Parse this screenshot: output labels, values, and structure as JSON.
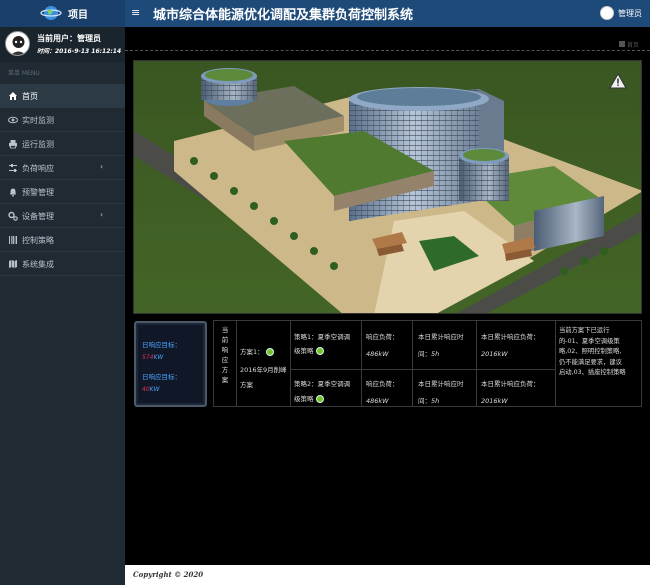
{
  "brand": {
    "label": "项目",
    "icon": "globe-icon"
  },
  "header": {
    "menu_icon": "≡",
    "title": "城市综合体能源优化调配及集群负荷控制系统",
    "user": "管理员"
  },
  "profile": {
    "current_user": "当前用户：管理员",
    "time": "时间：2016-9-13 16:12:14"
  },
  "menu": {
    "header": "菜单 MENU",
    "items": [
      {
        "label": "首页",
        "icon": "home-icon",
        "active": true
      },
      {
        "label": "实时监测",
        "icon": "eye-icon"
      },
      {
        "label": "运行监测",
        "icon": "printer-icon"
      },
      {
        "label": "负荷响应",
        "icon": "sliders-icon",
        "chevron": "‹"
      },
      {
        "label": "预警管理",
        "icon": "bell-icon"
      },
      {
        "label": "设备管理",
        "icon": "gears-icon",
        "chevron": "‹"
      },
      {
        "label": "控制策略",
        "icon": "barcode-icon"
      },
      {
        "label": "系统集成",
        "icon": "map-icon"
      }
    ]
  },
  "breadcrumb": "首页",
  "stats": {
    "target_label": "日响应目标：",
    "target_value": "574KW",
    "target_unit": "KW",
    "response_label": "日响应目标：",
    "response_value": "40KW",
    "response_unit": "KW"
  },
  "plan": {
    "header": "当前响应方案",
    "plan_label": "方案1：",
    "plan_date_1": "2016年9月削峰",
    "plan_date_2": "方案",
    "strategies": [
      {
        "name_1": "策略1：夏季空调调",
        "name_2": "级策略",
        "load_label": "响应负荷：",
        "load_value": "486kW",
        "time_label": "本日累计响应时",
        "time_label_2": "间：",
        "time_value": "5h",
        "total_label": "本日累计响应负荷：",
        "total_value": "2016kW"
      },
      {
        "name_1": "策略2：夏季空调调",
        "name_2": "级策略",
        "load_label": "响应负荷：",
        "load_value": "486kW",
        "time_label": "本日累计响应时",
        "time_label_2": "间：",
        "time_value": "5h",
        "total_label": "本日累计响应负荷：",
        "total_value": "2016kW"
      }
    ],
    "note_lines": [
      "当前方案下已运行",
      "的-01、夏季空调级策",
      "略,02、照明控制策略,",
      "仍不能满足要求，建议",
      "启动,03、插座控制策略"
    ]
  },
  "footer": "Copyright © 2020"
}
